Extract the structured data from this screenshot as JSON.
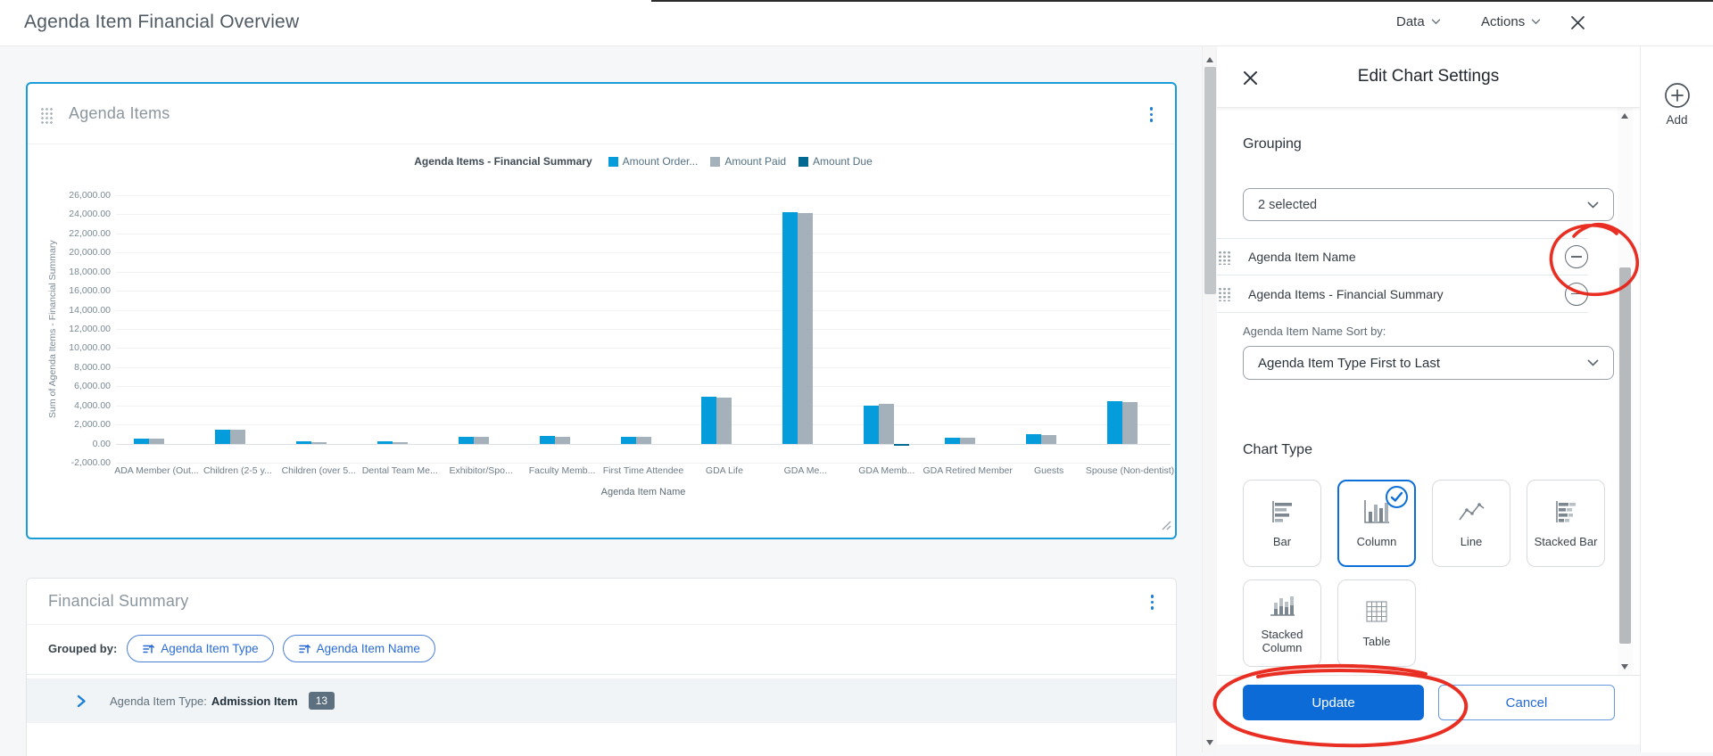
{
  "header": {
    "title": "Agenda Item Financial Overview",
    "data_menu": "Data",
    "actions_menu": "Actions"
  },
  "chart_panel": {
    "title": "Agenda Items"
  },
  "chart_data": {
    "type": "column",
    "title": "Agenda Items - Financial Summary",
    "xlabel": "Agenda Item Name",
    "ylabel": "Sum of Agenda Items - Financial Summary",
    "ylim": [
      -2000,
      26000
    ],
    "ytick_step": 2000,
    "grid": true,
    "legend_position": "top",
    "categories": [
      "ADA Member (Out...",
      "Children (2-5 y...",
      "Children (over 5...",
      "Dental Team Me...",
      "Exhibitor/Spo...",
      "Faculty Memb...",
      "First Time Attendee",
      "GDA Life",
      "GDA Me...",
      "GDA Memb...",
      "GDA Retired Member",
      "Guests",
      "Spouse (Non-dentist)"
    ],
    "series": [
      {
        "name": "Amount Order...",
        "color": "#049cdb",
        "values": [
          550,
          1500,
          200,
          200,
          750,
          800,
          700,
          4900,
          24200,
          3950,
          650,
          950,
          4400
        ]
      },
      {
        "name": "Amount Paid",
        "color": "#a4b1ba",
        "values": [
          500,
          1450,
          180,
          150,
          700,
          750,
          680,
          4850,
          24150,
          4200,
          620,
          900,
          4380
        ]
      },
      {
        "name": "Amount Due",
        "color": "#006a92",
        "values": [
          0,
          0,
          0,
          0,
          0,
          0,
          0,
          0,
          0,
          -200,
          0,
          0,
          0
        ]
      }
    ]
  },
  "summary_panel": {
    "title": "Financial Summary",
    "grouped_by_label": "Grouped by:",
    "group_pills": [
      "Agenda Item Type",
      "Agenda Item Name"
    ],
    "row": {
      "prefix": "Agenda Item Type:",
      "value": "Admission Item",
      "count": "13"
    }
  },
  "settings_panel": {
    "title": "Edit Chart Settings",
    "grouping_label": "Grouping",
    "grouping_dropdown_value": "2 selected",
    "grouping_items": [
      "Agenda Item Name",
      "Agenda Items - Financial Summary"
    ],
    "sort_label": "Agenda Item Name Sort by:",
    "sort_dropdown_value": "Agenda Item Type First to Last",
    "chart_type_label": "Chart Type",
    "chart_types": [
      {
        "label": "Bar",
        "selected": false
      },
      {
        "label": "Column",
        "selected": true
      },
      {
        "label": "Line",
        "selected": false
      },
      {
        "label": "Stacked Bar",
        "selected": false
      },
      {
        "label": "Stacked Column",
        "selected": false
      },
      {
        "label": "Table",
        "selected": false
      }
    ],
    "update_label": "Update",
    "cancel_label": "Cancel"
  },
  "right_rail": {
    "add_label": "Add"
  },
  "icons": {
    "close": "x-close",
    "chevron_down": "chevron-down",
    "kebab": "kebab-menu",
    "drag": "drag-handle-dots",
    "minus": "minus-circle",
    "plus": "plus-circle",
    "sort": "sort-lines-arrow",
    "check": "check-circle"
  },
  "colors": {
    "accent_blue": "#0d6bd8",
    "panel_selection_blue": "#1a9cd8",
    "link_blue": "#2a6cd4",
    "series_ordered": "#049cdb",
    "series_paid": "#a4b1ba",
    "series_due": "#006a92",
    "annotation_red": "#e71f13",
    "badge_slate": "#5c7080"
  }
}
